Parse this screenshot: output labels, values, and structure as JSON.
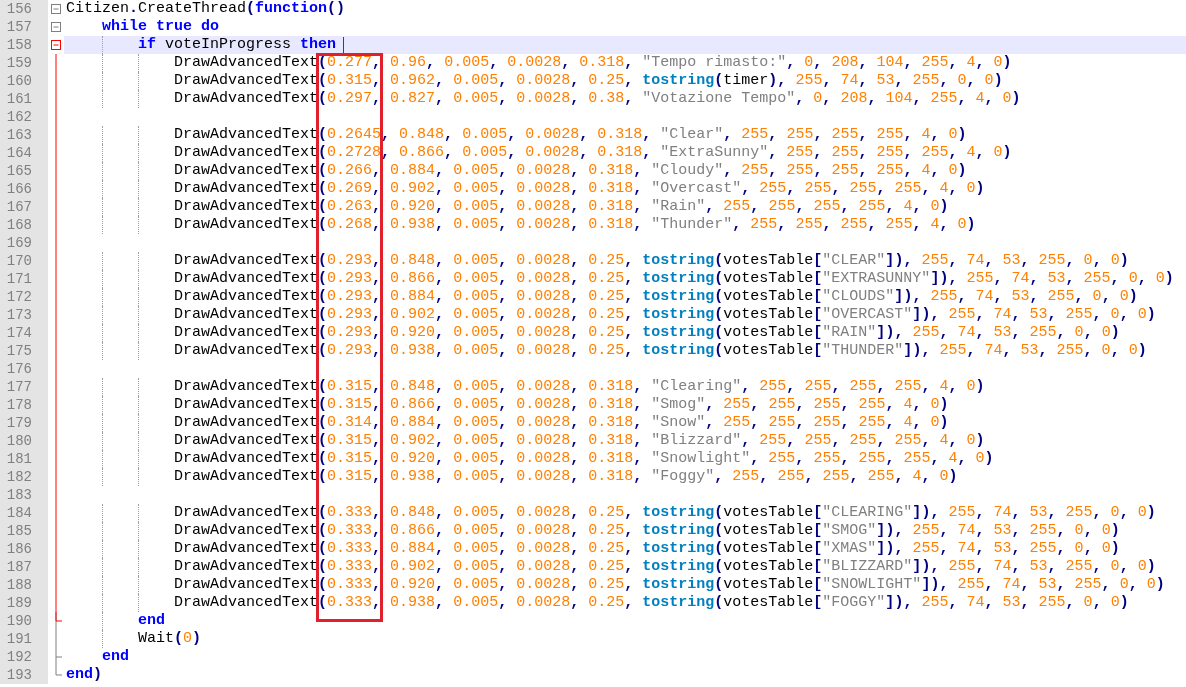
{
  "editor": {
    "lines": [
      {
        "number": "156",
        "kind": "block-start",
        "current": false,
        "code": [
          {
            "kind": "code",
            "text": "Citizen.CreateThread("
          },
          {
            "kind": "keyword",
            "text": "function"
          },
          {
            "kind": "code",
            "text": "()"
          }
        ]
      },
      {
        "number": "157",
        "kind": "block-start",
        "current": false,
        "code": [
          {
            "kind": "keyword",
            "text": "    while"
          },
          {
            "kind": "keyword",
            "text": " true"
          },
          {
            "kind": "keyword",
            "text": " do"
          }
        ]
      },
      {
        "number": "158",
        "kind": "block-start-active",
        "current": true,
        "code": [
          {
            "kind": "keyword",
            "text": "        if"
          },
          {
            "kind": "code",
            "text": " voteInProgress "
          },
          {
            "kind": "keyword",
            "text": "then"
          }
        ]
      },
      {
        "number": "159",
        "kind": "block-body-active",
        "current": false,
        "code": [
          {
            "kind": "code",
            "text": "            DrawAdvancedText(0.277, 0.96, 0.005, 0.0028, 0.318, \"Tempo rimasto:\", 0, 208, 104, 255, 4, 0)"
          }
        ]
      },
      {
        "number": "160",
        "kind": "block-body-active",
        "current": false,
        "code": [
          {
            "kind": "code",
            "text": "            DrawAdvancedText(0.315, 0.962, 0.005, 0.0028, 0.25, "
          },
          {
            "kind": "builtin",
            "text": "tostring"
          },
          {
            "kind": "code",
            "text": "(timer), 255, 74, 53, 255, 0, 0)"
          }
        ]
      },
      {
        "number": "161",
        "kind": "block-body-active",
        "current": false,
        "code": [
          {
            "kind": "code",
            "text": "            DrawAdvancedText(0.297, 0.827, 0.005, 0.0028, 0.38, \"Votazione Tempo\", 0, 208, 104, 255, 4, 0)"
          }
        ]
      },
      {
        "number": "162",
        "kind": "block-body-active",
        "current": false
      },
      {
        "number": "163",
        "kind": "block-body-active",
        "current": false,
        "code": [
          {
            "kind": "code",
            "text": "            DrawAdvancedText(0.2645, 0.848, 0.005, 0.0028, 0.318, \"Clear\", 255, 255, 255, 255, 4, 0)"
          }
        ]
      },
      {
        "number": "164",
        "kind": "block-body-active",
        "current": false,
        "code": [
          {
            "kind": "code",
            "text": "            DrawAdvancedText(0.2728, 0.866, 0.005, 0.0028, 0.318, \"ExtraSunny\", 255, 255, 255, 255, 4, 0)"
          }
        ]
      },
      {
        "number": "165",
        "kind": "block-body-active",
        "current": false,
        "code": [
          {
            "kind": "code",
            "text": "            DrawAdvancedText(0.266, 0.884, 0.005, 0.0028, 0.318, \"Cloudy\", 255, 255, 255, 255, 4, 0)"
          }
        ]
      },
      {
        "number": "166",
        "kind": "block-body-active",
        "current": false,
        "code": [
          {
            "kind": "code",
            "text": "            DrawAdvancedText(0.269, 0.902, 0.005, 0.0028, 0.318, \"Overcast\", 255, 255, 255, 255, 4, 0)"
          }
        ]
      },
      {
        "number": "167",
        "kind": "block-body-active",
        "current": false,
        "code": [
          {
            "kind": "code",
            "text": "            DrawAdvancedText(0.263, 0.920, 0.005, 0.0028, 0.318, \"Rain\", 255, 255, 255, 255, 4, 0)"
          }
        ]
      },
      {
        "number": "168",
        "kind": "block-body-active",
        "current": false,
        "code": [
          {
            "kind": "code",
            "text": "            DrawAdvancedText(0.268, 0.938, 0.005, 0.0028, 0.318, \"Thunder\", 255, 255, 255, 255, 4, 0)"
          }
        ]
      },
      {
        "number": "169",
        "kind": "block-body-active",
        "current": false
      },
      {
        "number": "170",
        "kind": "block-body-active",
        "current": false,
        "code": [
          {
            "kind": "code",
            "text": "            DrawAdvancedText(0.293, 0.848, 0.005, 0.0028, 0.25, "
          },
          {
            "kind": "builtin",
            "text": "tostring"
          },
          {
            "kind": "code",
            "text": "(votesTable[\"CLEAR\"]), 255, 74, 53, 255, 0, 0)"
          }
        ]
      },
      {
        "number": "171",
        "kind": "block-body-active",
        "current": false,
        "code": [
          {
            "kind": "code",
            "text": "            DrawAdvancedText(0.293, 0.866, 0.005, 0.0028, 0.25, "
          },
          {
            "kind": "builtin",
            "text": "tostring"
          },
          {
            "kind": "code",
            "text": "(votesTable[\"EXTRASUNNY\"]), 255, 74, 53, 255, 0, 0)"
          }
        ]
      },
      {
        "number": "172",
        "kind": "block-body-active",
        "current": false,
        "code": [
          {
            "kind": "code",
            "text": "            DrawAdvancedText(0.293, 0.884, 0.005, 0.0028, 0.25, "
          },
          {
            "kind": "builtin",
            "text": "tostring"
          },
          {
            "kind": "code",
            "text": "(votesTable[\"CLOUDS\"]), 255, 74, 53, 255, 0, 0)"
          }
        ]
      },
      {
        "number": "173",
        "kind": "block-body-active",
        "current": false,
        "code": [
          {
            "kind": "code",
            "text": "            DrawAdvancedText(0.293, 0.902, 0.005, 0.0028, 0.25, "
          },
          {
            "kind": "builtin",
            "text": "tostring"
          },
          {
            "kind": "code",
            "text": "(votesTable[\"OVERCAST\"]), 255, 74, 53, 255, 0, 0)"
          }
        ]
      },
      {
        "number": "174",
        "kind": "block-body-active",
        "current": false,
        "code": [
          {
            "kind": "code",
            "text": "            DrawAdvancedText(0.293, 0.920, 0.005, 0.0028, 0.25, "
          },
          {
            "kind": "builtin",
            "text": "tostring"
          },
          {
            "kind": "code",
            "text": "(votesTable[\"RAIN\"]), 255, 74, 53, 255, 0, 0)"
          }
        ]
      },
      {
        "number": "175",
        "kind": "block-body-active",
        "current": false,
        "code": [
          {
            "kind": "code",
            "text": "            DrawAdvancedText(0.293, 0.938, 0.005, 0.0028, 0.25, "
          },
          {
            "kind": "builtin",
            "text": "tostring"
          },
          {
            "kind": "code",
            "text": "(votesTable[\"THUNDER\"]), 255, 74, 53, 255, 0, 0)"
          }
        ]
      },
      {
        "number": "176",
        "kind": "block-body-active",
        "current": false
      },
      {
        "number": "177",
        "kind": "block-body-active",
        "current": false,
        "code": [
          {
            "kind": "code",
            "text": "            DrawAdvancedText(0.315, 0.848, 0.005, 0.0028, 0.318, \"Clearing\", 255, 255, 255, 255, 4, 0)"
          }
        ]
      },
      {
        "number": "178",
        "kind": "block-body-active",
        "current": false,
        "code": [
          {
            "kind": "code",
            "text": "            DrawAdvancedText(0.315, 0.866, 0.005, 0.0028, 0.318, \"Smog\", 255, 255, 255, 255, 4, 0)"
          }
        ]
      },
      {
        "number": "179",
        "kind": "block-body-active",
        "current": false,
        "code": [
          {
            "kind": "code",
            "text": "            DrawAdvancedText(0.314, 0.884, 0.005, 0.0028, 0.318, \"Snow\", 255, 255, 255, 255, 4, 0)"
          }
        ]
      },
      {
        "number": "180",
        "kind": "block-body-active",
        "current": false,
        "code": [
          {
            "kind": "code",
            "text": "            DrawAdvancedText(0.315, 0.902, 0.005, 0.0028, 0.318, \"Blizzard\", 255, 255, 255, 255, 4, 0)"
          }
        ]
      },
      {
        "number": "181",
        "kind": "block-body-active",
        "current": false,
        "code": [
          {
            "kind": "code",
            "text": "            DrawAdvancedText(0.315, 0.920, 0.005, 0.0028, 0.318, \"Snowlight\", 255, 255, 255, 255, 4, 0)"
          }
        ]
      },
      {
        "number": "182",
        "kind": "block-body-active",
        "current": false,
        "code": [
          {
            "kind": "code",
            "text": "            DrawAdvancedText(0.315, 0.938, 0.005, 0.0028, 0.318, \"Foggy\", 255, 255, 255, 255, 4, 0)"
          }
        ]
      },
      {
        "number": "183",
        "kind": "block-body-active",
        "current": false
      },
      {
        "number": "184",
        "kind": "block-body-active",
        "current": false,
        "code": [
          {
            "kind": "code",
            "text": "            DrawAdvancedText(0.333, 0.848, 0.005, 0.0028, 0.25, "
          },
          {
            "kind": "builtin",
            "text": "tostring"
          },
          {
            "kind": "code",
            "text": "(votesTable[\"CLEARING\"]), 255, 74, 53, 255, 0, 0)"
          }
        ]
      },
      {
        "number": "185",
        "kind": "block-body-active",
        "current": false,
        "code": [
          {
            "kind": "code",
            "text": "            DrawAdvancedText(0.333, 0.866, 0.005, 0.0028, 0.25, "
          },
          {
            "kind": "builtin",
            "text": "tostring"
          },
          {
            "kind": "code",
            "text": "(votesTable[\"SMOG\"]), 255, 74, 53, 255, 0, 0)"
          }
        ]
      },
      {
        "number": "186",
        "kind": "block-body-active",
        "current": false,
        "code": [
          {
            "kind": "code",
            "text": "            DrawAdvancedText(0.333, 0.884, 0.005, 0.0028, 0.25, "
          },
          {
            "kind": "builtin",
            "text": "tostring"
          },
          {
            "kind": "code",
            "text": "(votesTable[\"XMAS\"]), 255, 74, 53, 255, 0, 0)"
          }
        ]
      },
      {
        "number": "187",
        "kind": "block-body-active",
        "current": false,
        "code": [
          {
            "kind": "code",
            "text": "            DrawAdvancedText(0.333, 0.902, 0.005, 0.0028, 0.25, "
          },
          {
            "kind": "builtin",
            "text": "tostring"
          },
          {
            "kind": "code",
            "text": "(votesTable[\"BLIZZARD\"]), 255, 74, 53, 255, 0, 0)"
          }
        ]
      },
      {
        "number": "188",
        "kind": "block-body-active",
        "current": false,
        "code": [
          {
            "kind": "code",
            "text": "            DrawAdvancedText(0.333, 0.920, 0.005, 0.0028, 0.25, "
          },
          {
            "kind": "builtin",
            "text": "tostring"
          },
          {
            "kind": "code",
            "text": "(votesTable[\"SNOWLIGHT\"]), 255, 74, 53, 255, 0, 0)"
          }
        ]
      },
      {
        "number": "189",
        "kind": "block-body-active",
        "current": false,
        "code": [
          {
            "kind": "code",
            "text": "            DrawAdvancedText(0.333, 0.938, 0.005, 0.0028, 0.25, "
          },
          {
            "kind": "builtin",
            "text": "tostring"
          },
          {
            "kind": "code",
            "text": "(votesTable[\"FOGGY\"]), 255, 74, 53, 255, 0, 0)"
          }
        ]
      },
      {
        "number": "190",
        "kind": "block-end-active",
        "current": false,
        "code": [
          {
            "kind": "keyword",
            "text": "        end"
          }
        ]
      },
      {
        "number": "191",
        "kind": "block-body",
        "current": false,
        "code": [
          {
            "kind": "code",
            "text": "        Wait(0)"
          }
        ]
      },
      {
        "number": "192",
        "kind": "block-end",
        "current": false,
        "code": [
          {
            "kind": "keyword",
            "text": "    end"
          }
        ]
      },
      {
        "number": "193",
        "kind": "last-end",
        "current": false,
        "code": [
          {
            "kind": "keyword",
            "text": "end"
          },
          {
            "kind": "code",
            "text": ")"
          }
        ]
      }
    ]
  }
}
